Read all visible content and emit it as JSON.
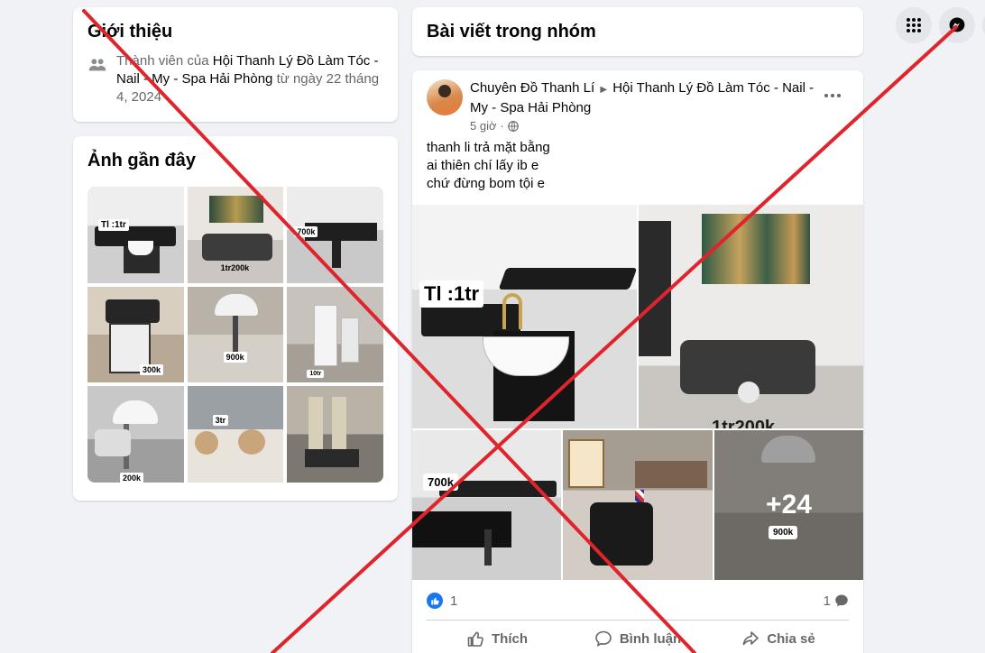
{
  "intro": {
    "title": "Giới thiệu",
    "prefix": "Thành viên của ",
    "group_name": "Hội Thanh Lý Đồ Làm Tóc - Nail - My - Spa Hải Phòng",
    "suffix": " từ ngày 22 tháng 4, 2024"
  },
  "recent_photos": {
    "title": "Ảnh gần đây",
    "labels": [
      "Tl :1tr",
      "1tr200k",
      "700k",
      "300k",
      "900k",
      "10tr",
      "200k",
      "3tr",
      ""
    ]
  },
  "posts_header": {
    "title": "Bài viết trong nhóm"
  },
  "post": {
    "author": "Chuyên Đồ Thanh Lí",
    "group": "Hội Thanh Lý Đồ Làm Tóc - Nail - My - Spa Hải Phòng",
    "time": "5 giờ",
    "separator": "·",
    "lines": [
      "thanh li trả mặt bằng",
      "ai thiên chí lấy ib e",
      "chứ đừng bom tội e"
    ],
    "media_labels": {
      "m1": "Tl :1tr",
      "m2": "1tr200k",
      "m3": "700k",
      "m5": "900k"
    },
    "more_count": "+24",
    "like_count": "1",
    "comment_count": "1",
    "actions": {
      "like": "Thích",
      "comment": "Bình luận",
      "share": "Chia sẻ"
    }
  },
  "colors": {
    "accent": "#1877f2",
    "cross": "#e0242b",
    "bg": "#f0f2f5"
  },
  "icons": {
    "apps": "grid-menu-icon",
    "messenger": "messenger-icon"
  }
}
